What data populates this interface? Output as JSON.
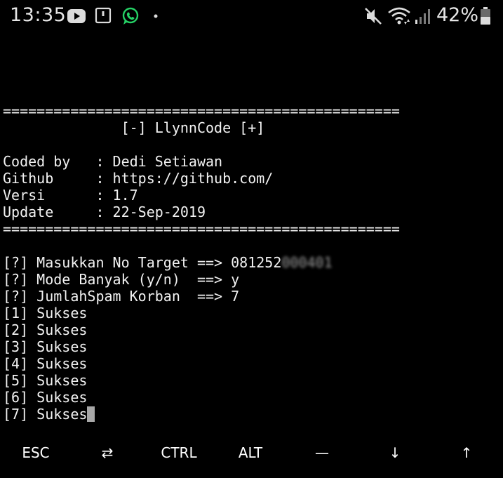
{
  "status_bar": {
    "time": "13:35",
    "battery": "42%",
    "icons": [
      "youtube-icon",
      "notification-square-icon",
      "whatsapp-icon",
      "dot-icon",
      "mute-icon",
      "wifi-icon",
      "signal-icon",
      "battery-icon"
    ]
  },
  "terminal": {
    "lines": [
      "===============================================",
      "              [-] LlynnCode [+]",
      "",
      "Coded by   : Dedi Setiawan",
      "Github     : https://github.com/",
      "Versi      : 1.7",
      "Update     : 22-Sep-2019",
      "===============================================",
      "",
      "",
      "[?] Mode Banyak (y/n)  ==> y",
      "[?] JumlahSpam Korban  ==> 7",
      "[1] Sukses",
      "[2] Sukses",
      "[3] Sukses",
      "[4] Sukses",
      "[5] Sukses",
      "[6] Sukses",
      "[7] Sukses"
    ],
    "target_prompt": "[?] Masukkan No Target ==> ",
    "target_visible": "081252",
    "target_obscured": "000401"
  },
  "extra_keys": {
    "esc": "ESC",
    "tab": "⇄",
    "ctrl": "CTRL",
    "alt": "ALT",
    "dash": "—",
    "down": "↓",
    "up": "↑"
  },
  "colors": {
    "background": "#000000",
    "text": "#f2f2f2",
    "cursor": "#a8a8a8",
    "status_text": "#e6e6e6",
    "whatsapp_green": "#25d366"
  }
}
